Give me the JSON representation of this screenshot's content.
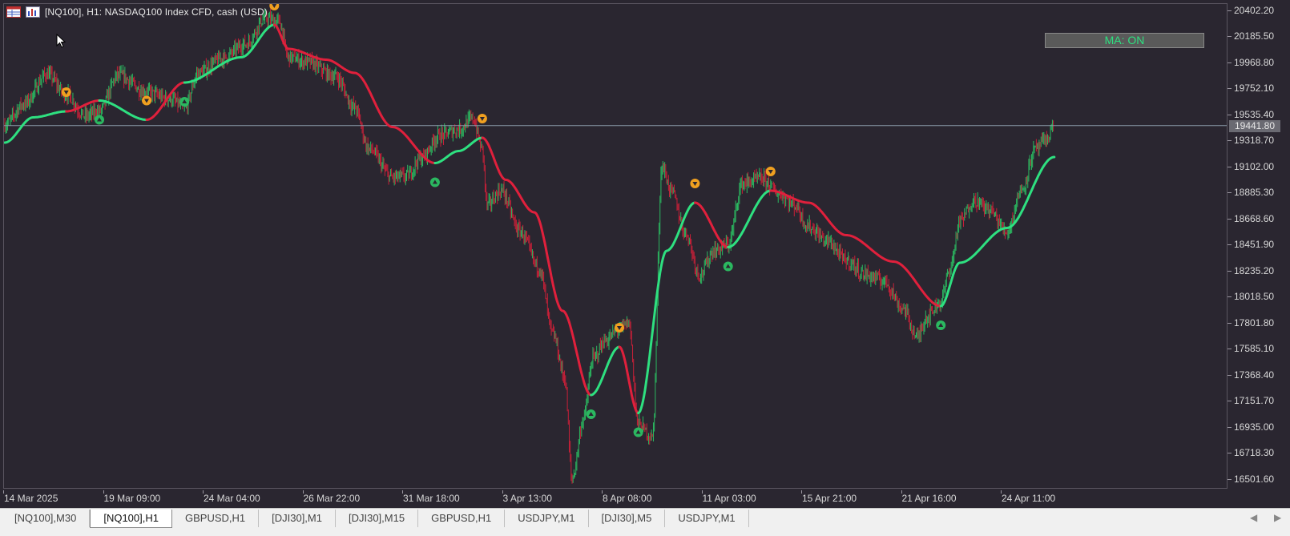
{
  "header": {
    "title": "[NQ100], H1:  NASDAQ100 Index CFD, cash (USD)",
    "icons": [
      "table-icon",
      "chart-window-icon"
    ]
  },
  "ma_button": {
    "label": "MA: ON"
  },
  "price_scale": {
    "labels": [
      "20402.20",
      "20185.50",
      "19968.80",
      "19752.10",
      "19535.40",
      "19318.70",
      "19102.00",
      "18885.30",
      "18668.60",
      "18451.90",
      "18235.20",
      "18018.50",
      "17801.80",
      "17585.10",
      "17368.40",
      "17151.70",
      "16935.00",
      "16718.30",
      "16501.60"
    ],
    "current_price": "19441.80"
  },
  "time_axis": {
    "labels": [
      "14 Mar 2025",
      "19 Mar 09:00",
      "24 Mar 04:00",
      "26 Mar 22:00",
      "31 Mar 18:00",
      "3 Apr 13:00",
      "8 Apr 08:00",
      "11 Apr 03:00",
      "15 Apr 21:00",
      "21 Apr 16:00",
      "24 Apr 11:00"
    ]
  },
  "tabs": [
    {
      "label": "[NQ100],M30",
      "active": false
    },
    {
      "label": "[NQ100],H1",
      "active": true
    },
    {
      "label": "GBPUSD,H1",
      "active": false
    },
    {
      "label": "[DJI30],M1",
      "active": false
    },
    {
      "label": "[DJI30],M15",
      "active": false
    },
    {
      "label": "GBPUSD,H1",
      "active": false
    },
    {
      "label": "USDJPY,M1",
      "active": false
    },
    {
      "label": "[DJI30],M5",
      "active": false
    },
    {
      "label": "USDJPY,M1",
      "active": false
    }
  ],
  "colors": {
    "background": "#2a2630",
    "ma_up": "#2ee080",
    "ma_down": "#e0203c",
    "candle_up": "#2bb860",
    "candle_down": "#c82038",
    "signal_sell": "#f0a020",
    "signal_buy": "#2bb860"
  },
  "chart_data": {
    "type": "candlestick",
    "symbol": "[NQ100]",
    "timeframe": "H1",
    "ylim": [
      16420,
      20460
    ],
    "current_price": 19441.8,
    "ma_line": [
      {
        "i": 0,
        "v": 19300
      },
      {
        "i": 30,
        "v": 19510
      },
      {
        "i": 65,
        "v": 19560
      },
      {
        "i": 100,
        "v": 19650
      },
      {
        "i": 150,
        "v": 19490
      },
      {
        "i": 190,
        "v": 19800
      },
      {
        "i": 250,
        "v": 20010
      },
      {
        "i": 285,
        "v": 20280
      },
      {
        "i": 300,
        "v": 20080
      },
      {
        "i": 340,
        "v": 19990
      },
      {
        "i": 370,
        "v": 19880
      },
      {
        "i": 410,
        "v": 19430
      },
      {
        "i": 455,
        "v": 19130
      },
      {
        "i": 480,
        "v": 19230
      },
      {
        "i": 505,
        "v": 19340
      },
      {
        "i": 530,
        "v": 18990
      },
      {
        "i": 560,
        "v": 18720
      },
      {
        "i": 590,
        "v": 17900
      },
      {
        "i": 620,
        "v": 17200
      },
      {
        "i": 650,
        "v": 17600
      },
      {
        "i": 670,
        "v": 17050
      },
      {
        "i": 700,
        "v": 18400
      },
      {
        "i": 730,
        "v": 18800
      },
      {
        "i": 765,
        "v": 18430
      },
      {
        "i": 810,
        "v": 18900
      },
      {
        "i": 850,
        "v": 18800
      },
      {
        "i": 890,
        "v": 18530
      },
      {
        "i": 940,
        "v": 18310
      },
      {
        "i": 990,
        "v": 17940
      },
      {
        "i": 1010,
        "v": 18300
      },
      {
        "i": 1060,
        "v": 18590
      },
      {
        "i": 1110,
        "v": 19180
      }
    ],
    "ma_segments": [
      {
        "from": 0,
        "to": 65,
        "trend": "up"
      },
      {
        "from": 65,
        "to": 100,
        "trend": "down"
      },
      {
        "from": 100,
        "to": 150,
        "trend": "up"
      },
      {
        "from": 150,
        "to": 190,
        "trend": "down"
      },
      {
        "from": 190,
        "to": 285,
        "trend": "up"
      },
      {
        "from": 285,
        "to": 455,
        "trend": "down"
      },
      {
        "from": 455,
        "to": 505,
        "trend": "up"
      },
      {
        "from": 505,
        "to": 620,
        "trend": "down"
      },
      {
        "from": 620,
        "to": 650,
        "trend": "up"
      },
      {
        "from": 650,
        "to": 670,
        "trend": "down"
      },
      {
        "from": 670,
        "to": 730,
        "trend": "up"
      },
      {
        "from": 730,
        "to": 765,
        "trend": "down"
      },
      {
        "from": 765,
        "to": 810,
        "trend": "up"
      },
      {
        "from": 810,
        "to": 990,
        "trend": "down"
      },
      {
        "from": 990,
        "to": 1110,
        "trend": "up"
      }
    ],
    "signals": [
      {
        "i": 65,
        "type": "sell"
      },
      {
        "i": 100,
        "type": "buy"
      },
      {
        "i": 150,
        "type": "sell"
      },
      {
        "i": 190,
        "type": "buy"
      },
      {
        "i": 285,
        "type": "sell"
      },
      {
        "i": 455,
        "type": "buy"
      },
      {
        "i": 505,
        "type": "sell"
      },
      {
        "i": 620,
        "type": "buy"
      },
      {
        "i": 650,
        "type": "sell"
      },
      {
        "i": 670,
        "type": "buy"
      },
      {
        "i": 730,
        "type": "sell"
      },
      {
        "i": 765,
        "type": "buy"
      },
      {
        "i": 810,
        "type": "sell"
      },
      {
        "i": 990,
        "type": "buy"
      }
    ],
    "price_path": [
      {
        "i": 0,
        "v": 19450
      },
      {
        "i": 20,
        "v": 19620
      },
      {
        "i": 45,
        "v": 19870
      },
      {
        "i": 65,
        "v": 19700
      },
      {
        "i": 85,
        "v": 19520
      },
      {
        "i": 100,
        "v": 19560
      },
      {
        "i": 120,
        "v": 19860
      },
      {
        "i": 150,
        "v": 19720
      },
      {
        "i": 175,
        "v": 19660
      },
      {
        "i": 190,
        "v": 19590
      },
      {
        "i": 205,
        "v": 19880
      },
      {
        "i": 230,
        "v": 20000
      },
      {
        "i": 255,
        "v": 20120
      },
      {
        "i": 275,
        "v": 20330
      },
      {
        "i": 290,
        "v": 20310
      },
      {
        "i": 300,
        "v": 20010
      },
      {
        "i": 320,
        "v": 19970
      },
      {
        "i": 350,
        "v": 19850
      },
      {
        "i": 370,
        "v": 19590
      },
      {
        "i": 385,
        "v": 19250
      },
      {
        "i": 410,
        "v": 19010
      },
      {
        "i": 425,
        "v": 19020
      },
      {
        "i": 440,
        "v": 19170
      },
      {
        "i": 460,
        "v": 19360
      },
      {
        "i": 480,
        "v": 19410
      },
      {
        "i": 495,
        "v": 19500
      },
      {
        "i": 505,
        "v": 19250
      },
      {
        "i": 510,
        "v": 18780
      },
      {
        "i": 525,
        "v": 18900
      },
      {
        "i": 545,
        "v": 18560
      },
      {
        "i": 565,
        "v": 18260
      },
      {
        "i": 580,
        "v": 17700
      },
      {
        "i": 592,
        "v": 17350
      },
      {
        "i": 600,
        "v": 16500
      },
      {
        "i": 612,
        "v": 17000
      },
      {
        "i": 622,
        "v": 17500
      },
      {
        "i": 635,
        "v": 17650
      },
      {
        "i": 650,
        "v": 17750
      },
      {
        "i": 660,
        "v": 17800
      },
      {
        "i": 670,
        "v": 16950
      },
      {
        "i": 685,
        "v": 16850
      },
      {
        "i": 695,
        "v": 19100
      },
      {
        "i": 705,
        "v": 18900
      },
      {
        "i": 720,
        "v": 18550
      },
      {
        "i": 735,
        "v": 18200
      },
      {
        "i": 750,
        "v": 18400
      },
      {
        "i": 765,
        "v": 18450
      },
      {
        "i": 780,
        "v": 18960
      },
      {
        "i": 800,
        "v": 19000
      },
      {
        "i": 820,
        "v": 18870
      },
      {
        "i": 835,
        "v": 18780
      },
      {
        "i": 850,
        "v": 18600
      },
      {
        "i": 870,
        "v": 18480
      },
      {
        "i": 890,
        "v": 18320
      },
      {
        "i": 910,
        "v": 18200
      },
      {
        "i": 930,
        "v": 18150
      },
      {
        "i": 950,
        "v": 17920
      },
      {
        "i": 965,
        "v": 17680
      },
      {
        "i": 975,
        "v": 17850
      },
      {
        "i": 990,
        "v": 17980
      },
      {
        "i": 1000,
        "v": 18260
      },
      {
        "i": 1010,
        "v": 18640
      },
      {
        "i": 1025,
        "v": 18820
      },
      {
        "i": 1040,
        "v": 18750
      },
      {
        "i": 1060,
        "v": 18560
      },
      {
        "i": 1075,
        "v": 18900
      },
      {
        "i": 1090,
        "v": 19240
      },
      {
        "i": 1100,
        "v": 19310
      },
      {
        "i": 1110,
        "v": 19442
      }
    ],
    "bars_count": 1110
  }
}
